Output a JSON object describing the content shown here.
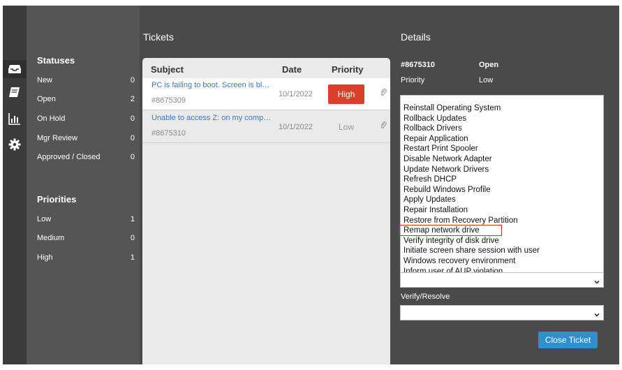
{
  "sidebar": {
    "statuses_title": "Statuses",
    "statuses": [
      {
        "label": "New",
        "count": "0"
      },
      {
        "label": "Open",
        "count": "2"
      },
      {
        "label": "On Hold",
        "count": "0"
      },
      {
        "label": "Mgr Review",
        "count": "0"
      },
      {
        "label": "Approved / Closed",
        "count": "0"
      }
    ],
    "priorities_title": "Priorities",
    "priorities": [
      {
        "label": "Low",
        "count": "1"
      },
      {
        "label": "Medium",
        "count": "0"
      },
      {
        "label": "High",
        "count": "1"
      }
    ]
  },
  "rail": {
    "icons": [
      "inbox-icon",
      "book-icon",
      "chart-icon",
      "gear-icon"
    ]
  },
  "tickets": {
    "title": "Tickets",
    "headers": {
      "subject": "Subject",
      "date": "Date",
      "priority": "Priority"
    },
    "rows": [
      {
        "subject": "PC is failing to boot. Screen is blank",
        "id": "#8675309",
        "date": "10/1/2022",
        "priority": "High"
      },
      {
        "subject": "Unable to access Z: on my computer",
        "id": "#8675310",
        "date": "10/1/2022",
        "priority": "Low"
      }
    ]
  },
  "details": {
    "title": "Details",
    "ticket_id": "#8675310",
    "status": "Open",
    "priority_label": "Priority",
    "priority_value": "Low",
    "actions": [
      "Reinstall Operating System",
      "Rollback Updates",
      "Rollback Drivers",
      "Repair Application",
      "Restart Print Spooler",
      "Disable Network Adapter",
      "Update Network Drivers",
      "Refresh DHCP",
      "Rebuild Windows Profile",
      "Apply Updates",
      "Repair Installation",
      "Restore from Recovery Partition",
      "Remap network drive",
      "Verify integrity of disk drive",
      "Initiate screen share session with user",
      "Windows recovery environment",
      "Inform user of AUP violation"
    ],
    "highlighted_action": "Remap network drive",
    "verify_label": "Verify/Resolve",
    "close_button": "Close Ticket"
  },
  "colors": {
    "background": "#4a4a4a",
    "sidebar": "#555555",
    "high_priority": "#d9402b",
    "link": "#3b78c2",
    "button": "#2f8fd0"
  }
}
